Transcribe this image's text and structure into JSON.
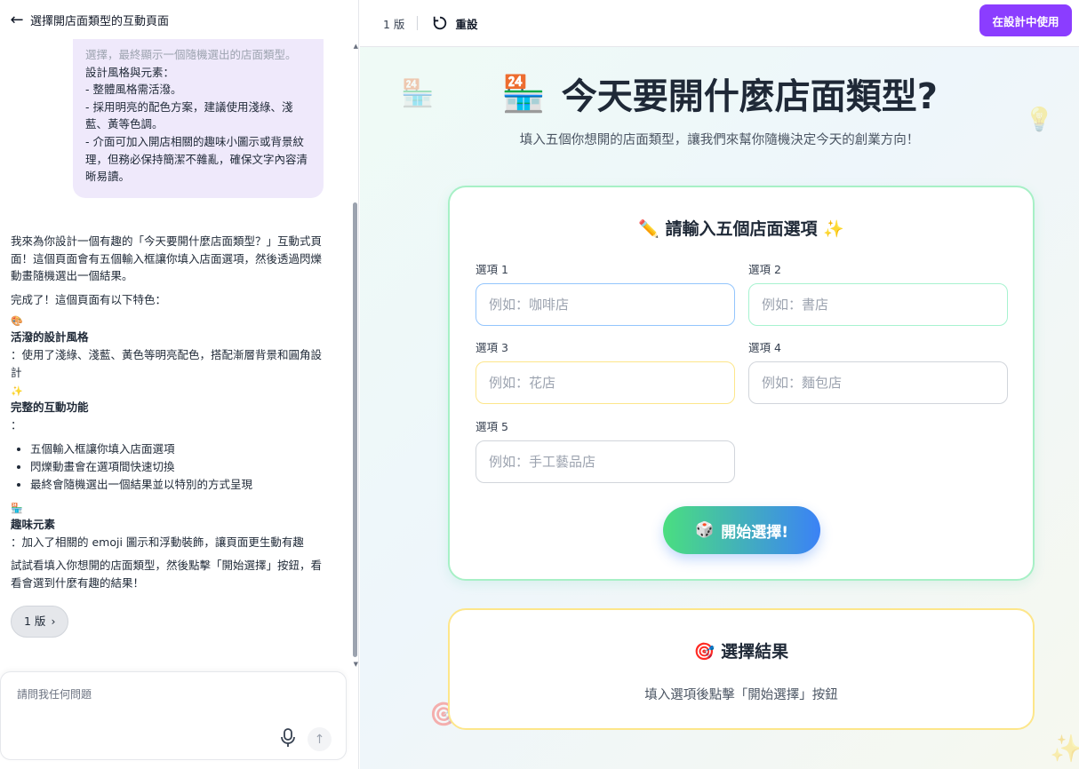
{
  "left": {
    "header_title": "選擇開店面類型的互動頁面",
    "user_message": {
      "faded_line": "選擇，最終顯示一個隨機選出的店面類型。",
      "lines": [
        "設計風格與元素：",
        "- 整體風格需活潑。",
        "- 採用明亮的配色方案，建議使用淺綠、淺藍、黃等色調。",
        "- 介面可加入開店相關的趣味小圖示或背景紋理，但務必保持簡潔不雜亂，確保文字內容清晰易讀。"
      ]
    },
    "assistant": {
      "intro": "我來為你設計一個有趣的「今天要開什麼店面類型？」互動式頁面！這個頁面會有五個輸入框讓你填入店面選項，然後透過閃爍動畫隨機選出一個結果。",
      "done": "完成了！這個頁面有以下特色：",
      "feature1_title": "活潑的設計風格",
      "feature1_desc": "：使用了淺綠、淺藍、黃色等明亮配色，搭配漸層背景和圓角設計",
      "feature2_title": "完整的互動功能",
      "feature2_desc": "：",
      "bullets": [
        "五個輸入框讓你填入店面選項",
        "閃爍動畫會在選項間快速切換",
        "最終會隨機選出一個結果並以特別的方式呈現"
      ],
      "feature3_title": "趣味元素",
      "feature3_desc": "：加入了相關的 emoji 圖示和浮動裝飾，讓頁面更生動有趣",
      "closing": "試試看填入你想開的店面類型，然後點擊「開始選擇」按鈕，看看會選到什麼有趣的結果！"
    },
    "version_chip": "1 版",
    "chat_placeholder": "請問我任何問題"
  },
  "topbar": {
    "version": "1 版",
    "reset": "重設",
    "use_in_design": "在設計中使用"
  },
  "page": {
    "title": "今天要開什麼店面類型?",
    "subtitle": "填入五個你想開的店面類型，讓我們來幫你隨機決定今天的創業方向！",
    "card_title": "請輸入五個店面選項",
    "fields": [
      {
        "label": "選項 1",
        "placeholder": "例如：咖啡店"
      },
      {
        "label": "選項 2",
        "placeholder": "例如：書店"
      },
      {
        "label": "選項 3",
        "placeholder": "例如：花店"
      },
      {
        "label": "選項 4",
        "placeholder": "例如：麵包店"
      },
      {
        "label": "選項 5",
        "placeholder": "例如：手工藝品店"
      }
    ],
    "start_button": "開始選擇!",
    "result_title": "選擇結果",
    "result_hint": "填入選項後點擊「開始選擇」按鈕"
  },
  "colors": {
    "accent": "#8b3dff",
    "card_border": "#a7f0c6",
    "result_border": "#fde68a",
    "start_from": "#4ade80",
    "start_to": "#3b82f6"
  },
  "icons": {
    "back": "arrow-left-icon",
    "reset": "refresh-icon",
    "store": "convenience-store-icon",
    "pencil": "pencil-icon",
    "sparkles": "sparkles-icon",
    "dice": "dice-icon",
    "target": "target-icon",
    "bulb": "light-bulb-icon",
    "mic": "microphone-icon",
    "send": "arrow-up-icon"
  }
}
